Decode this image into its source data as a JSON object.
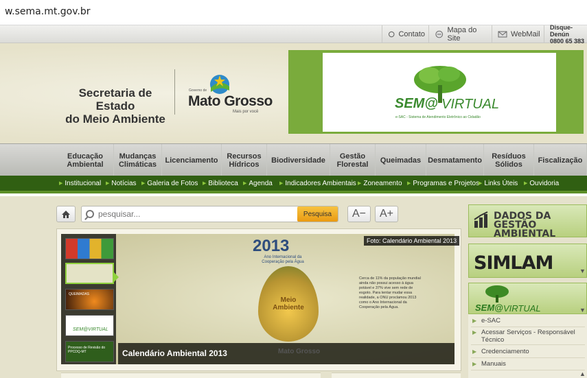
{
  "browser": {
    "url": "w.sema.mt.gov.br"
  },
  "topbar": {
    "contato": "Contato",
    "mapa": "Mapa do Site",
    "webmail": "WebMail",
    "disque_label": "Disque-Denún",
    "disque_number": "0800 65 383"
  },
  "header": {
    "secretaria_line1": "Secretaria de Estado",
    "secretaria_line2": "do Meio Ambiente",
    "gov_small": "Governo de",
    "mt_logo": "Mato Grosso",
    "mt_tagline": "Mais por você",
    "banner_sem": "SEM@",
    "banner_virtual": "VIRTUAL",
    "banner_sub": "e-SAC - Sistema de Atendimento Eletrônico ao Cidadão"
  },
  "mainnav": [
    {
      "l1": "Educação",
      "l2": "Ambiental"
    },
    {
      "l1": "Mudanças",
      "l2": "Climáticas"
    },
    {
      "l1": "Licenciamento",
      "l2": ""
    },
    {
      "l1": "Recursos",
      "l2": "Hídricos"
    },
    {
      "l1": "Biodiversidade",
      "l2": ""
    },
    {
      "l1": "Gestão",
      "l2": "Florestal"
    },
    {
      "l1": "Queimadas",
      "l2": ""
    },
    {
      "l1": "Desmatamento",
      "l2": ""
    },
    {
      "l1": "Resíduos",
      "l2": "Sólidos"
    },
    {
      "l1": "Fiscalização",
      "l2": ""
    }
  ],
  "subnav": [
    "Institucional",
    "Notícias",
    "Galeria de Fotos",
    "Biblioteca",
    "Agenda",
    "Indicadores Ambientais",
    "Zoneamento",
    "Programas e Projetos",
    "Links Úteis",
    "Ouvidoria"
  ],
  "search": {
    "placeholder": "pesquisar...",
    "button": "Pesquisa",
    "font_minus": "A−",
    "font_plus": "A+"
  },
  "slider": {
    "foto_credit": "Foto: Calendário Ambiental 2013",
    "caption": "Calendário Ambiental 2013",
    "year": "2013",
    "year_sub": "Ano Internacional da Cooperação pela Água",
    "paragraph": "Cerca de 11% da população mundial ainda não possui acesso à água potável e 37% vive sem rede de esgoto. Para tentar mudar essa realidade, a ONU proclamou 2013 como o Ano Internacional da Cooperação pela Água.",
    "drop_text": "Meio Ambiente",
    "footer_logo": "Mato Grosso",
    "thumbs": [
      "QUEIMADAS",
      "SEM@VIRTUAL",
      "Processo de Revisão do PPCDQ-MT"
    ]
  },
  "sidebar": {
    "dados_l1": "DADOS DA",
    "dados_l2": "GESTÃO AMBIENTAL",
    "simlam": "SIMLAM",
    "sem": "SEM@",
    "virtual": "VIRTUAL",
    "links": [
      "e-SAC",
      "Acessar Serviços - Responsável Técnico",
      "Credenciamento",
      "Manuais"
    ]
  }
}
